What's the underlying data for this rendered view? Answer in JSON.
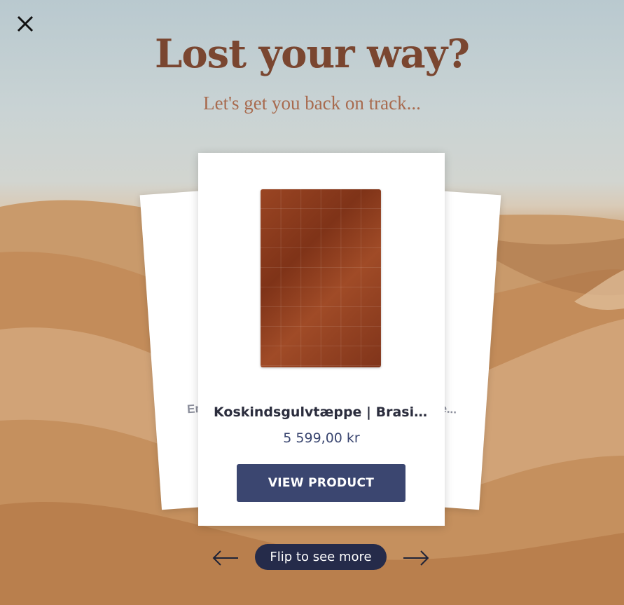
{
  "modal": {
    "title": "Lost your way?",
    "subtitle": "Let's get you back on track..."
  },
  "cards": {
    "left_peek_text": "En",
    "right_peek_text": "le...",
    "current": {
      "name": "Koskindsgulvtæppe | Brasilian...",
      "price": "5 599,00 kr",
      "button_label": "VIEW PRODUCT",
      "image": "brown-cowhide-patchwork-rug"
    }
  },
  "nav": {
    "label": "Flip to see more",
    "prev_icon": "arrow-left-icon",
    "next_icon": "arrow-right-icon"
  },
  "icons": {
    "close": "close-icon"
  },
  "colors": {
    "title": "#7a4630",
    "subtitle": "#a86b4f",
    "button": "#3b4670",
    "pill": "#252b4a"
  }
}
